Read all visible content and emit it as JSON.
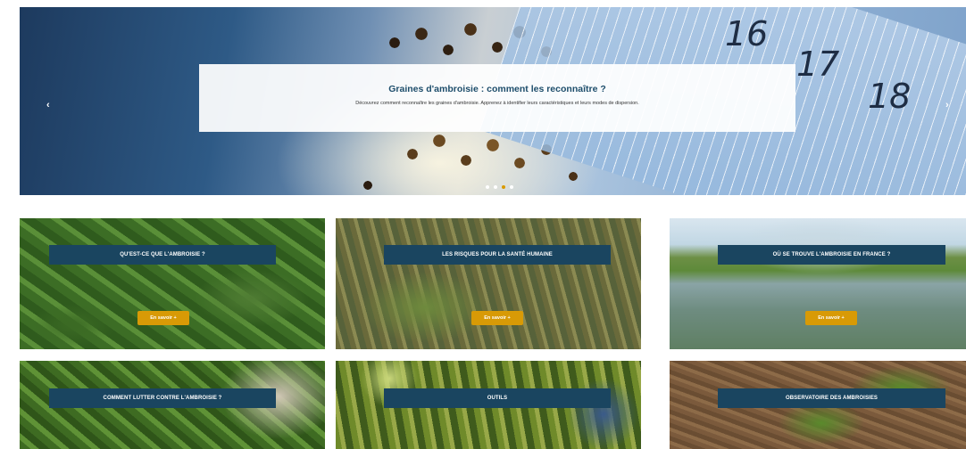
{
  "carousel": {
    "title": "Graines d'ambroisie : comment les reconnaître ?",
    "description": "Découvrez comment reconnaître les graines d'ambroisie. Apprenez à identifier leurs caractéristiques et leurs modes de dispersion.",
    "prev_label": "‹",
    "next_label": "›",
    "slide_count": 4,
    "active_slide": 3,
    "ruler_numbers": [
      "16",
      "17",
      "18"
    ]
  },
  "tiles": [
    {
      "label": "QU'EST-CE QUE L'AMBROISIE ?",
      "button": "En savoir +"
    },
    {
      "label": "LES RISQUES POUR LA SANTÉ HUMAINE",
      "button": "En savoir +"
    },
    {
      "label": "OÙ SE TROUVE L'AMBROISIE EN FRANCE ?",
      "button": "En savoir +"
    },
    {
      "label": "COMMENT LUTTER CONTRE L'AMBROISIE ?"
    },
    {
      "label": "OUTILS"
    },
    {
      "label": "OBSERVATOIRE DES AMBROISIES"
    }
  ],
  "colors": {
    "label_bg": "#1a4560",
    "button_bg": "#d89a06",
    "title_color": "#1d4d6b",
    "active_dot": "#d99a00"
  }
}
